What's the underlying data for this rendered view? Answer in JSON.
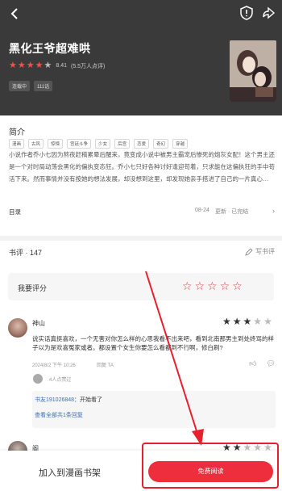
{
  "header": {
    "title": "黑化王爷超难哄",
    "rating_stars": {
      "full": 4,
      "empty": 1
    },
    "score": "8.41",
    "score_count": "(5.5万人点评)",
    "chips": [
      "连载中",
      "111话"
    ]
  },
  "intro": {
    "title": "简介",
    "genre_tags": [
      "漫画",
      "古风",
      "惊悚",
      "宫廷斗争",
      "少女",
      "后宫",
      "恋爱",
      "奇幻",
      "穿越"
    ],
    "description": "小说作者乔小七因为熬夜赶稿累晕后醒来，竟变成小说中被男主霸宠后惨死的炮灰女配！这个男主还是一个对时局动荡会黑化的偏执变态狂。乔小七只好各种讨好逢迎苟着，只求能在这偏执狂的手中苟活下来。然而事情并没有按她的想法发展，却没想到这里，却发现她亲手搭进了自己的一片真心…",
    "catalog_label": "目录",
    "catalog_date": "08-24",
    "catalog_status": "更新 · 已完结"
  },
  "reviews": {
    "title": "书评 · 147",
    "write_label": "写书评",
    "my_rating_label": "我要评分",
    "items": [
      {
        "name": "神山",
        "stars": {
          "full": 3,
          "empty": 2
        },
        "text": "说实话真挺喜欢，一个无害对你怎么样的心思我看不出来吧，看到北南那男主到处终骂的样子以为是欢喜冤家或者。都设置个女生你要怎么看都到不行啊，修白刷?",
        "date": "2024/8/2 下午 10:26",
        "follow": "回复 TA",
        "likes_text": "4人点赞过",
        "reply_user": "书友191026848",
        "reply_text": "：开始看了",
        "reply_more": "查看全部共1条回复"
      },
      {
        "name": "阁",
        "stars": {
          "full": 2,
          "empty": 3
        }
      }
    ]
  },
  "bottom": {
    "add_shelf": "加入到漫画书架",
    "free_read": "免费阅读"
  },
  "colors": {
    "accent": "#ee2d3d",
    "header_bg": "#3a3a3a",
    "link": "#3b6fb6"
  }
}
